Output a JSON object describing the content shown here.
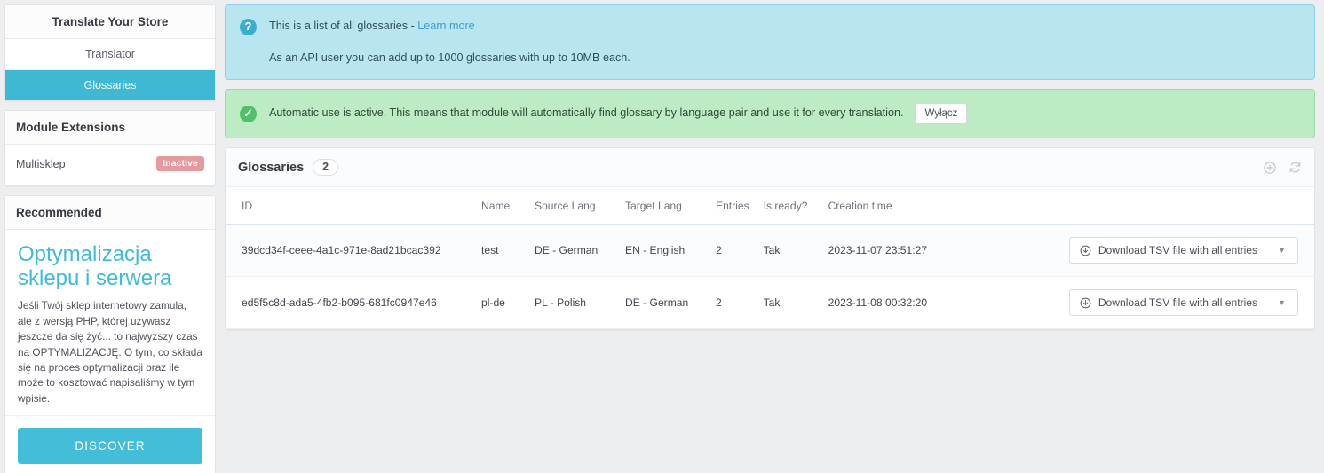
{
  "sidebar": {
    "title": "Translate Your Store",
    "nav": [
      {
        "label": "Translator",
        "active": false
      },
      {
        "label": "Glossaries",
        "active": true
      }
    ],
    "extensions": {
      "title": "Module Extensions",
      "rows": [
        {
          "name": "Multisklep",
          "status": "Inactive"
        }
      ]
    },
    "recommended": {
      "title": "Recommended",
      "promo_title": "Optymalizacja sklepu i serwera",
      "promo_text": "Jeśli Twój sklep internetowy zamula, ale z wersją PHP, której używasz jeszcze da się żyć... to najwyższy czas na OPTYMALIZACJĘ. O tym, co składa się na proces optymalizacji oraz ile może to kosztować napisaliśmy w tym wpisie.",
      "cta_label": "DISCOVER"
    }
  },
  "alerts": {
    "info": {
      "icon": "question-circle-icon",
      "line1_prefix": "This is a list of all glossaries - ",
      "line1_link": "Learn more",
      "line2": "As an API user you can add up to 1000 glossaries with up to 10MB each."
    },
    "success": {
      "icon": "check-circle-icon",
      "text": "Automatic use is active. This means that module will automatically find glossary by language pair and use it for every translation.",
      "button_label": "Wyłącz"
    }
  },
  "glossaries_card": {
    "title": "Glossaries",
    "count": "2",
    "actions": {
      "add_icon": "plus-circle-icon",
      "refresh_icon": "refresh-icon"
    },
    "columns": [
      "ID",
      "Name",
      "Source Lang",
      "Target Lang",
      "Entries",
      "Is ready?",
      "Creation time",
      ""
    ],
    "rows": [
      {
        "id": "39dcd34f-ceee-4a1c-971e-8ad21bcac392",
        "name": "test",
        "source_lang": "DE - German",
        "target_lang": "EN - English",
        "entries": "2",
        "is_ready": "Tak",
        "creation_time": "2023-11-07 23:51:27",
        "download_label": "Download TSV file with all entries"
      },
      {
        "id": "ed5f5c8d-ada5-4fb2-b095-681fc0947e46",
        "name": "pl-de",
        "source_lang": "PL - Polish",
        "target_lang": "DE - German",
        "entries": "2",
        "is_ready": "Tak",
        "creation_time": "2023-11-08 00:32:20",
        "download_label": "Download TSV file with all entries"
      }
    ]
  },
  "colors": {
    "accent": "#3fb8d4",
    "info_bg": "#b8e5f0",
    "success_bg": "#bdebc4",
    "inactive_badge": "#e79a9e",
    "link": "#3d9dd4"
  }
}
